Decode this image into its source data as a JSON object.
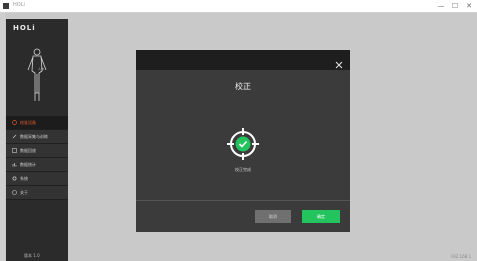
{
  "window": {
    "title": "HOLi",
    "controls": [
      "—",
      "☐",
      "✕"
    ]
  },
  "sidebar": {
    "logo": "HOLi",
    "figure_caption": "人体",
    "items": [
      {
        "label": "校准设备",
        "active": true
      },
      {
        "label": "数据采集与训练",
        "active": false
      },
      {
        "label": "数据回放",
        "active": false
      },
      {
        "label": "数据统计",
        "active": false
      },
      {
        "label": "系统",
        "active": false
      },
      {
        "label": "关于",
        "active": false
      }
    ],
    "footer": "版本 1.0"
  },
  "bottom_right": "192.168.1",
  "modal": {
    "title": "校正",
    "status": "校正完成",
    "cancel_label": "取消",
    "confirm_label": "确定"
  },
  "colors": {
    "accent": "#23c45e",
    "active_text": "#e25a2c",
    "modal_bg": "#3b3b3b"
  }
}
